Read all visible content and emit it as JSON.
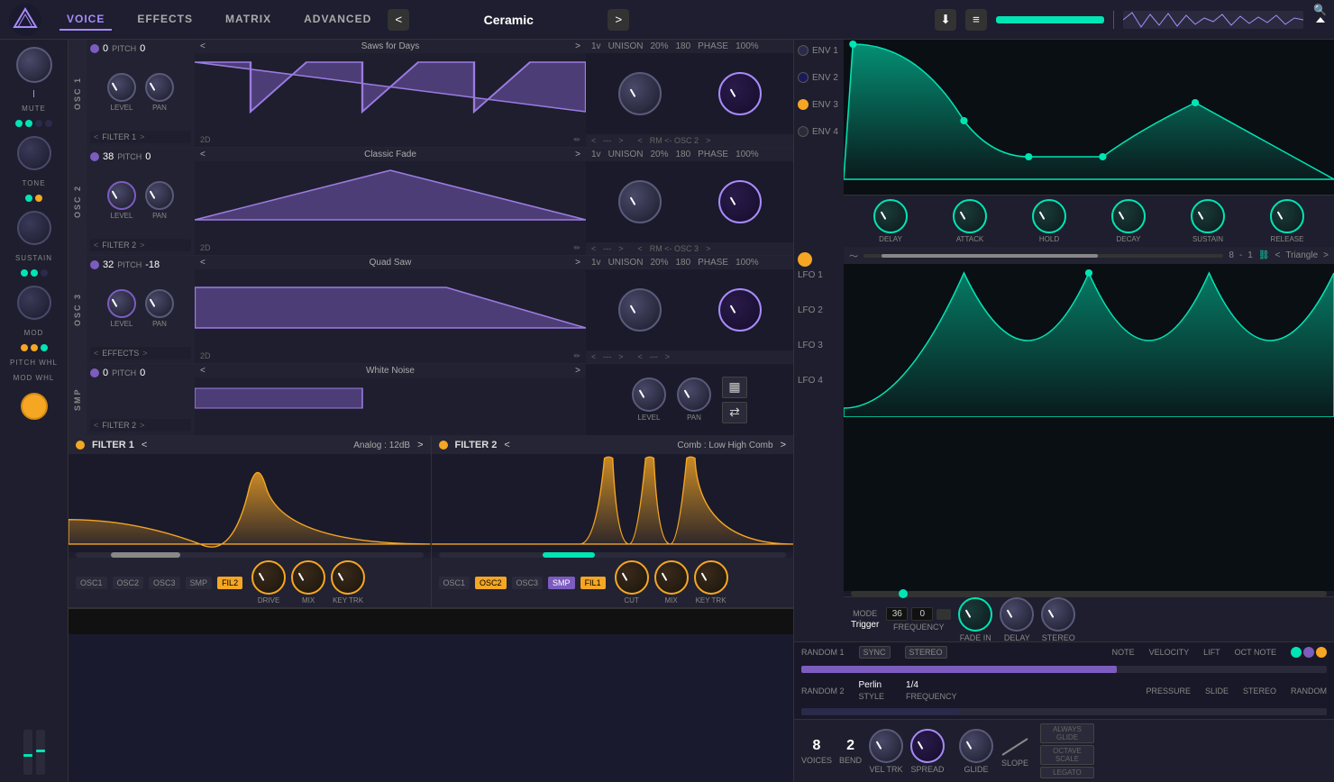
{
  "app": {
    "logo": "V",
    "tabs": [
      "VOICE",
      "EFFECTS",
      "MATRIX",
      "ADVANCED"
    ],
    "active_tab": "VOICE",
    "preset_name": "Ceramic",
    "nav_arrows": [
      "<",
      ">"
    ]
  },
  "left_strip": {
    "knob1_label": "MUTE",
    "knob2_label": "TONE",
    "knob3_label": "SUSTAIN",
    "knob4_label": "MOD",
    "knob5_label": "PITCH WHL",
    "knob6_label": "MOD WHL"
  },
  "osc": [
    {
      "id": "OSC 1",
      "pitch_left": "0",
      "pitch_right": "0",
      "wave_name": "Saws for Days",
      "filter": "FILTER 1",
      "unison": "1v",
      "unison_pct": "20%",
      "phase_val": "180",
      "phase_pct": "100%",
      "route": "RM <- OSC 2",
      "wave_type": "saw"
    },
    {
      "id": "OSC 2",
      "pitch_left": "38",
      "pitch_right": "0",
      "wave_name": "Classic Fade",
      "filter": "FILTER 2",
      "unison": "1v",
      "unison_pct": "20%",
      "phase_val": "180",
      "phase_pct": "100%",
      "route": "RM <- OSC 3",
      "wave_type": "triangle"
    },
    {
      "id": "OSC 3",
      "pitch_left": "32",
      "pitch_right": "-18",
      "wave_name": "Quad Saw",
      "filter": "EFFECTS",
      "unison": "1v",
      "unison_pct": "20%",
      "phase_val": "180",
      "phase_pct": "100%",
      "route": "---",
      "wave_type": "quad_saw"
    }
  ],
  "smp": {
    "id": "SMP",
    "pitch_left": "0",
    "pitch_right": "0",
    "wave_name": "White Noise",
    "filter": "FILTER 2"
  },
  "filter1": {
    "name": "FILTER 1",
    "preset": "Analog : 12dB",
    "sources": [
      "OSC1",
      "OSC2",
      "OSC3",
      "SMP"
    ],
    "active": "FIL2",
    "knobs": [
      "DRIVE",
      "MIX",
      "KEY TRK"
    ]
  },
  "filter2": {
    "name": "FILTER 2",
    "preset": "Comb : Low High Comb",
    "sources": [
      "OSC1",
      "OSC2",
      "OSC3",
      "SMP"
    ],
    "active_osc": "OSC2",
    "active_bottom": "FIL1",
    "knobs": [
      "CUT",
      "MIX",
      "KEY TRK"
    ]
  },
  "env": {
    "labels": [
      "ENV 1",
      "ENV 2",
      "ENV 3",
      "ENV 4"
    ],
    "knobs": [
      "DELAY",
      "ATTACK",
      "HOLD",
      "DECAY",
      "SUSTAIN",
      "RELEASE"
    ]
  },
  "lfo": {
    "labels": [
      "LFO 1",
      "LFO 2",
      "LFO 3",
      "LFO 4"
    ],
    "wave_name": "Triangle",
    "rate": "8",
    "division": "1",
    "controls": {
      "mode_label": "MODE",
      "mode_val": "Trigger",
      "freq_label": "FREQUENCY",
      "freq_left": "36",
      "freq_right": "0",
      "fade_in_label": "FADE IN",
      "delay_label": "DELAY",
      "stereo_label": "STEREO"
    }
  },
  "random": {
    "labels": [
      "RANDOM 1",
      "RANDOM 2"
    ],
    "r1_cols": [
      "SYNC",
      "STEREO",
      "NOTE",
      "VELOCITY",
      "LIFT",
      "OCT NOTE"
    ],
    "r2_cols": [
      "PRESSURE",
      "SLIDE",
      "STEREO",
      "RANDOM"
    ],
    "style": "Perlin",
    "style_label": "STYLE",
    "frequency": "1/4",
    "freq_label": "FREQUENCY"
  },
  "voice": {
    "voices": "8",
    "voices_label": "VOICES",
    "bend": "2",
    "bend_label": "BEND",
    "vel_trk_label": "VEL TRK",
    "spread_label": "SPREAD",
    "glide_label": "GLIDE",
    "slope_label": "SLOPE",
    "always_glide": "ALWAYS GLIDE",
    "octave_scale": "OCTAVE SCALE",
    "legato": "LEGATO"
  }
}
